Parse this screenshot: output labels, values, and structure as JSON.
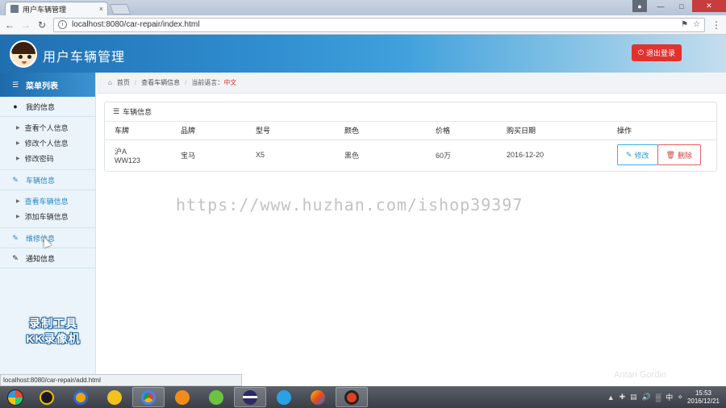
{
  "browser": {
    "tab_title": "用户车辆管理",
    "tab_close": "×",
    "url": "localhost:8080/car-repair/index.html",
    "status_url": "localhost:8080/car-repair/add.html"
  },
  "header": {
    "title": "用户车辆管理",
    "logout_label": "退出登录",
    "logout_color": "#e0322f"
  },
  "sidebar": {
    "menu_title": "菜单列表",
    "groups": [
      {
        "label": "我的信息",
        "icon": "user-icon",
        "items": [
          "查看个人信息",
          "修改个人信息",
          "修改密码"
        ]
      },
      {
        "label": "车辆信息",
        "icon": "edit-icon",
        "items": [
          "查看车辆信息",
          "添加车辆信息"
        ]
      },
      {
        "label": "维修信息",
        "icon": "edit-icon",
        "items": []
      },
      {
        "label": "通知信息",
        "icon": "edit-icon",
        "items": []
      }
    ],
    "watermark_line1": "录制工具",
    "watermark_line2": "KK录像机"
  },
  "breadcrumb": {
    "home": "首页",
    "current": "查看车辆信息",
    "lang_label": "当前语言：",
    "lang_value": "中文"
  },
  "panel": {
    "title": "车辆信息",
    "columns": [
      "车牌",
      "品牌",
      "型号",
      "颜色",
      "价格",
      "购买日期",
      "操作"
    ],
    "rows": [
      {
        "plate_line1": "沪A",
        "plate_line2": "WW123",
        "brand": "宝马",
        "model": "X5",
        "color": "黑色",
        "price": "60万",
        "date": "2016-12-20"
      }
    ],
    "edit_label": "修改",
    "delete_label": "删除"
  },
  "overlay_watermark": "https://www.huzhan.com/ishop39397",
  "taskbar": {
    "tray_watermark": "Antan Gordin",
    "input_method": "中",
    "time": "15:53",
    "date": "2016/12/21"
  }
}
